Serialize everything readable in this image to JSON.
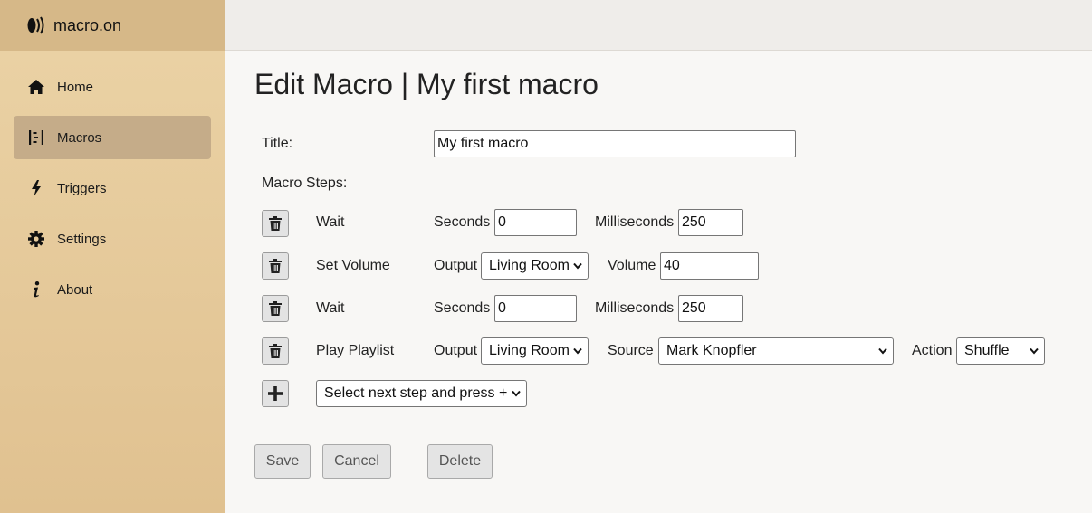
{
  "app": {
    "name": "macro.on"
  },
  "sidebar": {
    "items": [
      {
        "label": "Home",
        "icon": "home-icon"
      },
      {
        "label": "Macros",
        "icon": "macros-icon",
        "active": true
      },
      {
        "label": "Triggers",
        "icon": "bolt-icon"
      },
      {
        "label": "Settings",
        "icon": "gear-icon"
      },
      {
        "label": "About",
        "icon": "info-icon"
      }
    ]
  },
  "page": {
    "title": "Edit Macro | My first macro"
  },
  "form": {
    "title_label": "Title:",
    "title_value": "My first macro",
    "steps_label": "Macro Steps:",
    "steps": [
      {
        "name": "Wait",
        "seconds_label": "Seconds",
        "seconds": "0",
        "ms_label": "Milliseconds",
        "ms": "250"
      },
      {
        "name": "Set Volume",
        "output_label": "Output",
        "output": "Living Room",
        "volume_label": "Volume",
        "volume": "40"
      },
      {
        "name": "Wait",
        "seconds_label": "Seconds",
        "seconds": "0",
        "ms_label": "Milliseconds",
        "ms": "250"
      },
      {
        "name": "Play Playlist",
        "output_label": "Output",
        "output": "Living Room",
        "source_label": "Source",
        "source": "Mark Knopfler",
        "action_label": "Action",
        "action": "Shuffle"
      }
    ],
    "next_step_select": "Select next step and press +"
  },
  "buttons": {
    "save": "Save",
    "cancel": "Cancel",
    "delete": "Delete"
  },
  "colors": {
    "sidebar_bg": "#e6cb9c",
    "sidebar_header": "#d6b888",
    "active_item": "#c5ac89",
    "page_bg": "#f8f7f5"
  }
}
